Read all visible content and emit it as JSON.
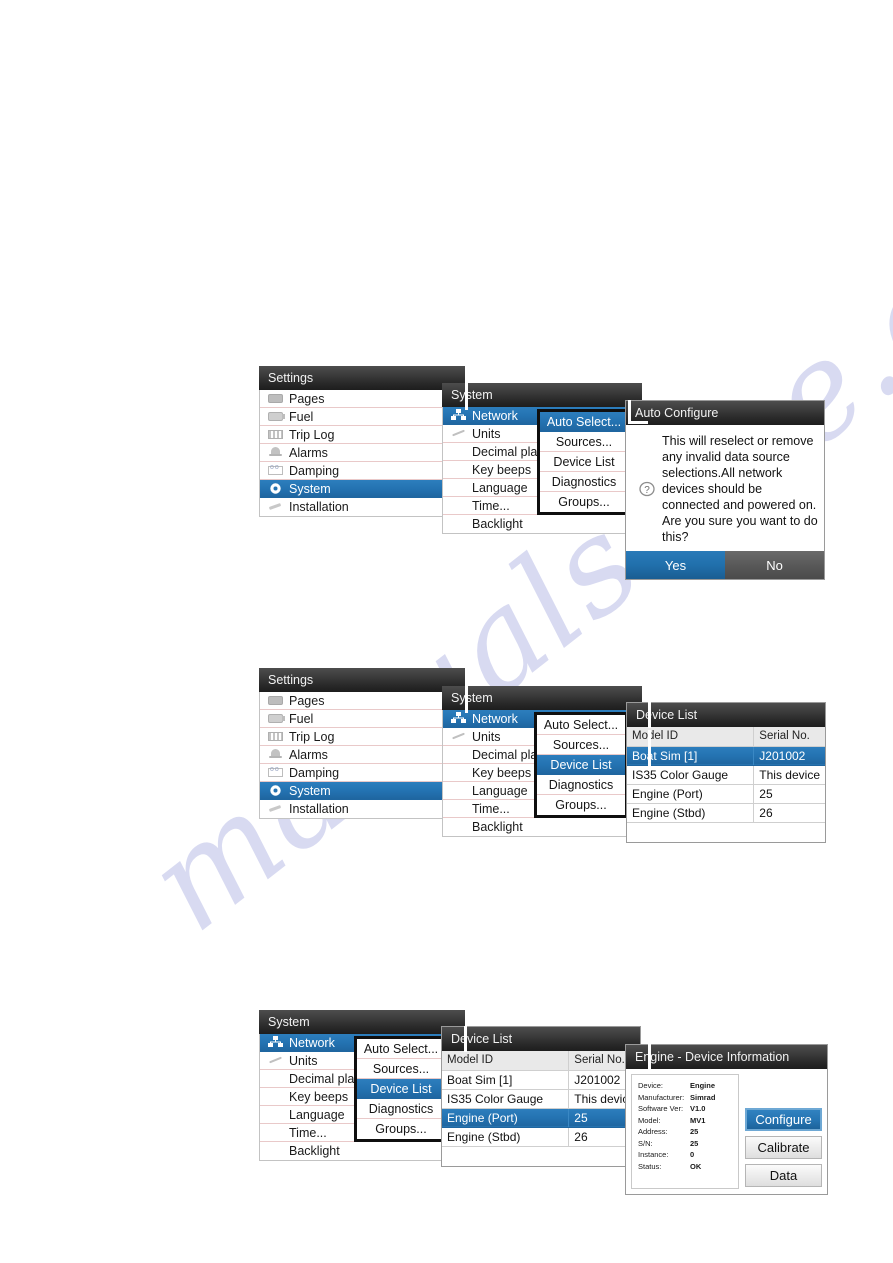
{
  "watermark": {
    "text": "manualshive.com"
  },
  "settings_menu": {
    "title": "Settings",
    "items": [
      {
        "label": "Pages",
        "icon": "pages-icon",
        "selected": false
      },
      {
        "label": "Fuel",
        "icon": "fuel-icon",
        "selected": false
      },
      {
        "label": "Trip Log",
        "icon": "trip-log-icon",
        "selected": false
      },
      {
        "label": "Alarms",
        "icon": "alarm-bell-icon",
        "selected": false
      },
      {
        "label": "Damping",
        "icon": "damping-icon",
        "selected": false
      },
      {
        "label": "System",
        "icon": "gear-icon",
        "selected": true
      },
      {
        "label": "Installation",
        "icon": "wrench-icon",
        "selected": false
      }
    ]
  },
  "system_menu": {
    "title": "System",
    "items": [
      {
        "label": "Network",
        "icon": "network-icon",
        "selected": true
      },
      {
        "label": "Units",
        "icon": "units-icon",
        "selected": false
      },
      {
        "label": "Decimal places",
        "icon": "blank-icon",
        "selected": false
      },
      {
        "label": "Key beeps",
        "icon": "blank-icon",
        "selected": false
      },
      {
        "label": "Language",
        "icon": "blank-icon",
        "selected": false
      },
      {
        "label": "Time...",
        "icon": "blank-icon",
        "selected": false
      },
      {
        "label": "Backlight",
        "icon": "blank-icon",
        "selected": false
      }
    ]
  },
  "network_submenu": {
    "items": [
      {
        "label": "Auto Select..."
      },
      {
        "label": "Sources..."
      },
      {
        "label": "Device List"
      },
      {
        "label": "Diagnostics"
      },
      {
        "label": "Groups..."
      }
    ],
    "selected_first": "Auto Select...",
    "selected_second": "Device List"
  },
  "auto_configure_dialog": {
    "title": "Auto Configure",
    "message": "This will reselect or remove any invalid data source selections.All network devices should be connected and powered on. Are you sure you want to do this?",
    "yes_label": "Yes",
    "no_label": "No",
    "icon": "question-mark-icon"
  },
  "device_list": {
    "title": "Device List",
    "columns": [
      "Model ID",
      "Serial No."
    ],
    "rows": [
      {
        "model": "Boat Sim [1]",
        "serial": "J201002",
        "selected_panel2": true,
        "selected_panel3": false
      },
      {
        "model": "IS35 Color Gauge",
        "serial": "This device",
        "selected_panel2": false,
        "selected_panel3": false
      },
      {
        "model": "Engine (Port)",
        "serial": "25",
        "selected_panel2": false,
        "selected_panel3": true
      },
      {
        "model": "Engine (Stbd)",
        "serial": "26",
        "selected_panel2": false,
        "selected_panel3": false
      }
    ]
  },
  "device_information": {
    "title": "Engine - Device Information",
    "fields": [
      {
        "key": "Device:",
        "value": "Engine"
      },
      {
        "key": "Manufacturer:",
        "value": "Simrad"
      },
      {
        "key": "Software Ver:",
        "value": "V1.0"
      },
      {
        "key": "Model:",
        "value": "MV1"
      },
      {
        "key": "Address:",
        "value": "25"
      },
      {
        "key": "S/N:",
        "value": "25"
      },
      {
        "key": "Instance:",
        "value": "0"
      },
      {
        "key": "Status:",
        "value": "OK"
      }
    ],
    "buttons": [
      {
        "label": "Configure",
        "primary": true
      },
      {
        "label": "Calibrate",
        "primary": false
      },
      {
        "label": "Data",
        "primary": false
      }
    ]
  },
  "colors": {
    "accent_blue": "#2473b2",
    "titlebar_dark": "#2a2a2a",
    "row_divider": "#e9c9c9",
    "watermark": "#b9bde6"
  }
}
